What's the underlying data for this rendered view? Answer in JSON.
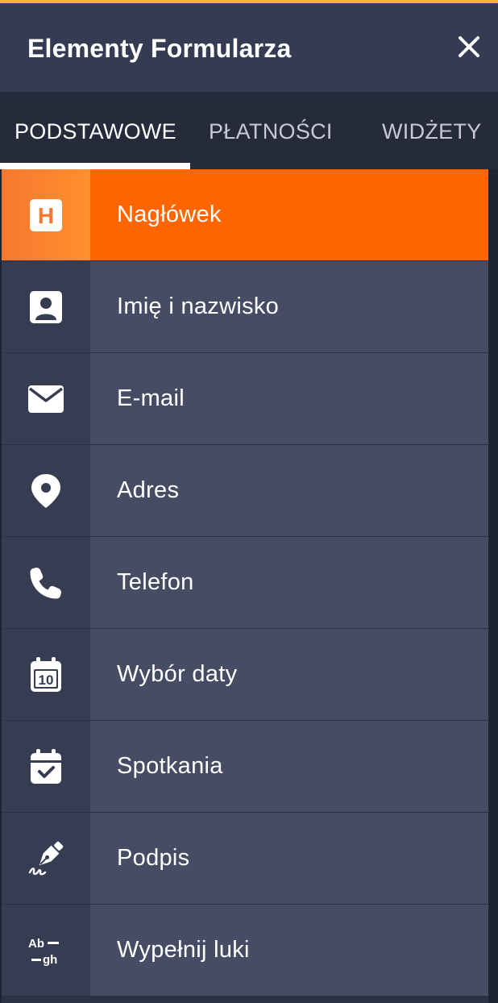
{
  "header": {
    "title": "Elementy Formularza",
    "close_icon": "close-icon"
  },
  "tabs": [
    {
      "label": "PODSTAWOWE",
      "active": true
    },
    {
      "label": "PŁATNOŚCI",
      "active": false
    },
    {
      "label": "WIDŻETY",
      "active": false
    }
  ],
  "items": [
    {
      "label": "Nagłówek",
      "icon": "heading-icon",
      "active": true
    },
    {
      "label": "Imię i nazwisko",
      "icon": "person-card-icon",
      "active": false
    },
    {
      "label": "E-mail",
      "icon": "envelope-icon",
      "active": false
    },
    {
      "label": "Adres",
      "icon": "map-pin-icon",
      "active": false
    },
    {
      "label": "Telefon",
      "icon": "phone-icon",
      "active": false
    },
    {
      "label": "Wybór daty",
      "icon": "calendar-date-icon",
      "active": false
    },
    {
      "label": "Spotkania",
      "icon": "calendar-check-icon",
      "active": false
    },
    {
      "label": "Podpis",
      "icon": "signature-pen-icon",
      "active": false
    },
    {
      "label": "Wypełnij luki",
      "icon": "fill-blanks-icon",
      "active": false
    }
  ],
  "icon_text": {
    "heading": "H",
    "date_number": "10",
    "fill_top": "Ab",
    "fill_bottom": "gh"
  },
  "colors": {
    "accent": "#ff6500",
    "top_border": "#f6b23a",
    "header_bg": "#343b52",
    "item_bg": "#454c63"
  }
}
